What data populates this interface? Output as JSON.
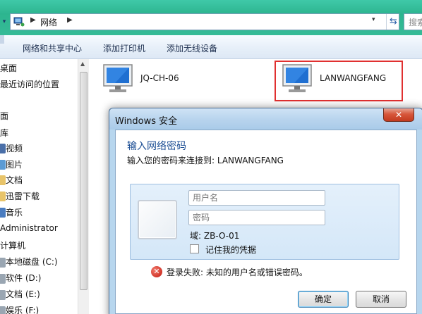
{
  "address": {
    "path": "网络",
    "search_placeholder": "搜索网络"
  },
  "toolbar": {
    "items": [
      "网络和共享中心",
      "添加打印机",
      "添加无线设备"
    ]
  },
  "sidebar": {
    "items": [
      "桌面",
      "最近访问的位置",
      "面",
      "库",
      "视频",
      "图片",
      "文档",
      "迅雷下载",
      "音乐",
      "Administrator",
      "计算机",
      "本地磁盘 (C:)",
      "软件 (D:)",
      "文档 (E:)",
      "娱乐 (F:)"
    ]
  },
  "main": {
    "computers": [
      "JQ-CH-06",
      "LANWANGFANG"
    ]
  },
  "dialog": {
    "title": "Windows 安全",
    "close_label": "✕",
    "heading": "输入网络密码",
    "subheading": "输入您的密码来连接到: LANWANGFANG",
    "username_placeholder": "用户名",
    "password_placeholder": "密码",
    "domain_text": "域: ZB-O-01",
    "remember_label": "记住我的凭据",
    "error_text": "登录失败: 未知的用户名或错误密码。",
    "ok_label": "确定",
    "cancel_label": "取消"
  },
  "colors": {
    "accent": "#1c4e94",
    "highlight": "#e03030",
    "titlebar": "#b7d6ee",
    "aero": "#36bb97"
  }
}
